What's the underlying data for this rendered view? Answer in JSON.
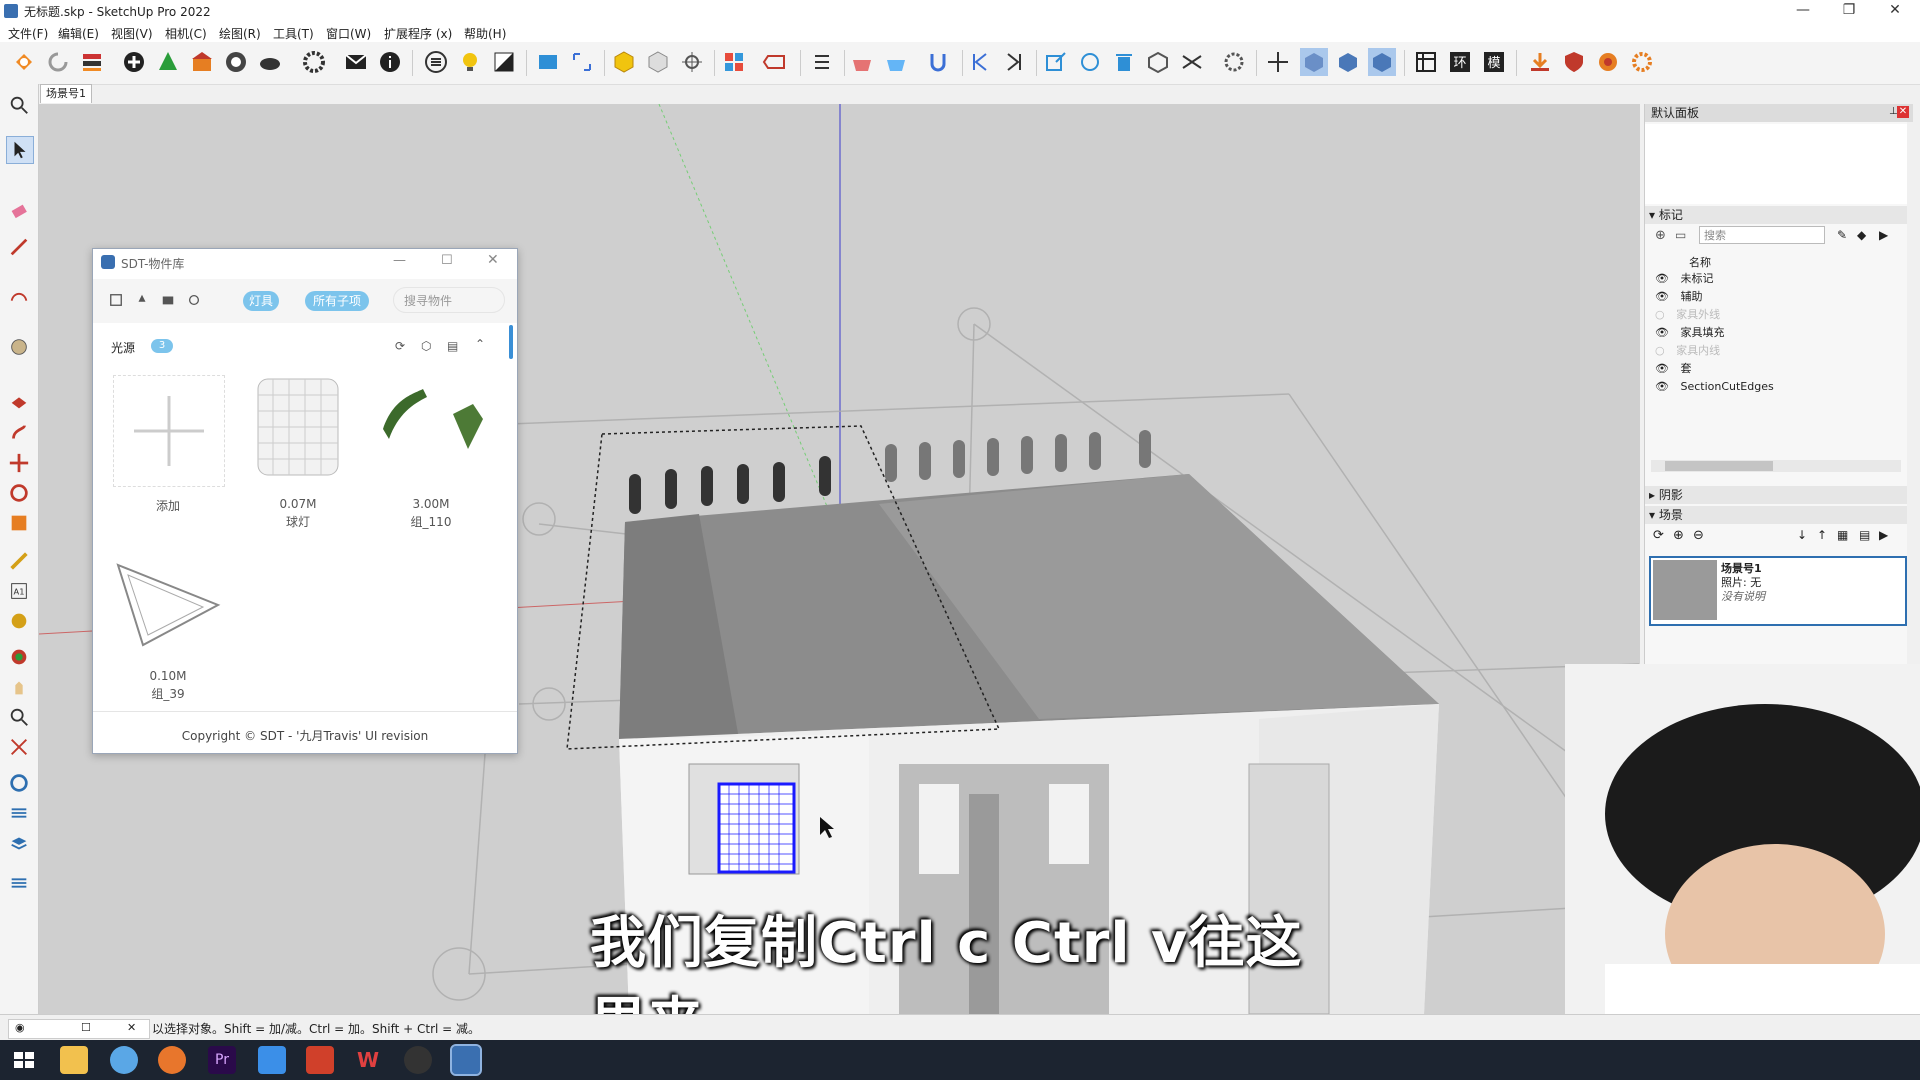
{
  "window": {
    "title": "无标题.skp - SketchUp Pro 2022",
    "minimize": "—",
    "restore": "❐",
    "close": "✕"
  },
  "menu": [
    "文件(F)",
    "编辑(E)",
    "视图(V)",
    "相机(C)",
    "绘图(R)",
    "工具(T)",
    "窗口(W)",
    "扩展程序 (x)",
    "帮助(H)"
  ],
  "scene_tab": "场景号1",
  "sdt": {
    "title": "SDT-物件库",
    "tab_lights": "灯具",
    "tab_all": "所有子项",
    "search_placeholder": "搜寻物件",
    "section_label": "光源",
    "section_count": "3",
    "items": [
      {
        "size": "",
        "name": "添加"
      },
      {
        "size": "0.07M",
        "name": "球灯"
      },
      {
        "size": "3.00M",
        "name": "组_110"
      },
      {
        "size": "0.10M",
        "name": "组_39"
      }
    ],
    "footer": "Copyright © SDT  - '九月Travis' UI revision"
  },
  "right_panel": {
    "default_panel": "默认面板",
    "tags_header": "标记",
    "tags_search_placeholder": "搜索",
    "tags_col_name": "名称",
    "tags": [
      {
        "name": "未标记",
        "visible": true
      },
      {
        "name": "辅助",
        "visible": true
      },
      {
        "name": "家具外线",
        "visible": false
      },
      {
        "name": "家具填充",
        "visible": true
      },
      {
        "name": "家具内线",
        "visible": false
      },
      {
        "name": "套",
        "visible": true
      },
      {
        "name": "SectionCutEdges",
        "visible": true
      }
    ],
    "shadow_header": "阴影",
    "scenes_header": "场景",
    "scene": {
      "name": "场景号1",
      "photo": "照片: 无",
      "desc": "没有说明"
    }
  },
  "status_text": "以选择对象。Shift = 加/减。Ctrl = 加。Shift + Ctrl = 减。",
  "subtitle": "我们复制Ctrl c Ctrl v往这里来",
  "colors": {
    "accent": "#7cc4ec",
    "selection": "#1a1aff"
  }
}
